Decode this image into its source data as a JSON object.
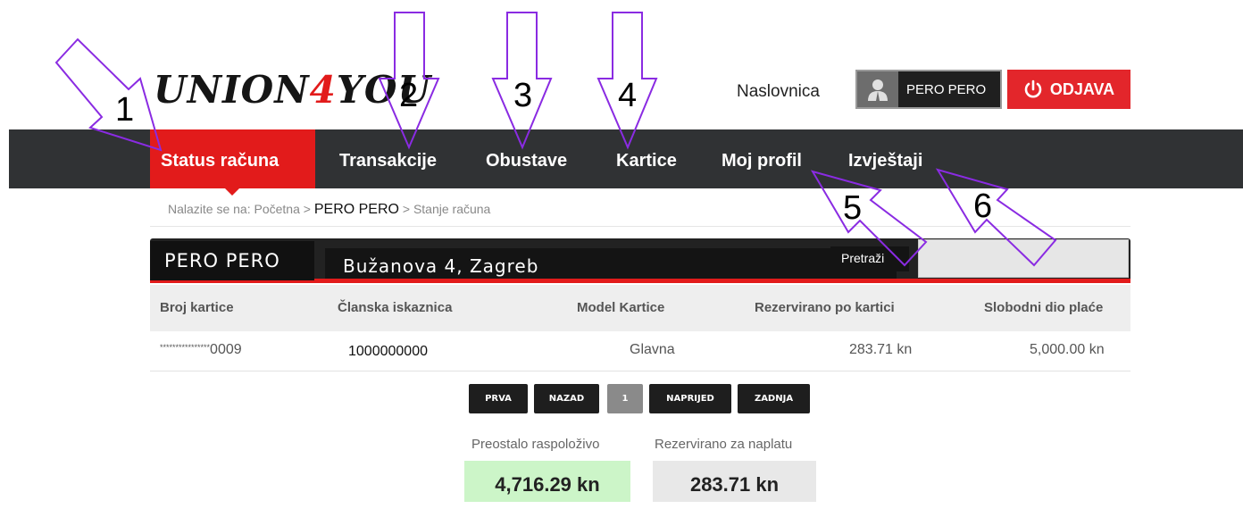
{
  "logo": {
    "part1": "UNION",
    "part2": "4",
    "part3": "YOU"
  },
  "header": {
    "home_link": "Naslovnica",
    "user_button": "PERO PERO",
    "logout_button": "ODJAVA"
  },
  "nav": {
    "items": [
      {
        "label": "Status računa",
        "active": true
      },
      {
        "label": "Transakcije"
      },
      {
        "label": "Obustave"
      },
      {
        "label": "Kartice"
      },
      {
        "label": "Moj profil"
      },
      {
        "label": "Izvještaji"
      }
    ]
  },
  "breadcrumb": {
    "prefix": "Nalazite se na:",
    "home": "Početna",
    "sep": ">",
    "user": "PERO PERO",
    "current": "Stanje računa"
  },
  "account_bar": {
    "name": "PERO PERO",
    "address": "Bužanova 4, Zagreb",
    "search_button": "Pretraži",
    "search_value": ""
  },
  "table": {
    "headers": [
      "Broj kartice",
      "Članska iskaznica",
      "Model Kartice",
      "Rezervirano po kartici",
      "Slobodni dio plaće"
    ],
    "rows": [
      {
        "mask": "****************",
        "last4": "0009",
        "member_id": "1000000000",
        "model": "Glavna",
        "reserved": "283.71 kn",
        "free": "5,000.00 kn"
      }
    ]
  },
  "pager": {
    "first": "PRVA",
    "prev": "NAZAD",
    "current": "1",
    "next": "NAPRIJED",
    "last": "ZADNJA"
  },
  "summary": {
    "available_label": "Preostalo raspoloživo",
    "available_value": "4,716.29 kn",
    "reserved_label": "Rezervirano za naplatu",
    "reserved_value": "283.71 kn"
  },
  "annotations": [
    "1",
    "2",
    "3",
    "4",
    "5",
    "6"
  ],
  "colors": {
    "accent": "#e21b1b",
    "nav_bg": "#303234",
    "arrow": "#8a2be2"
  }
}
